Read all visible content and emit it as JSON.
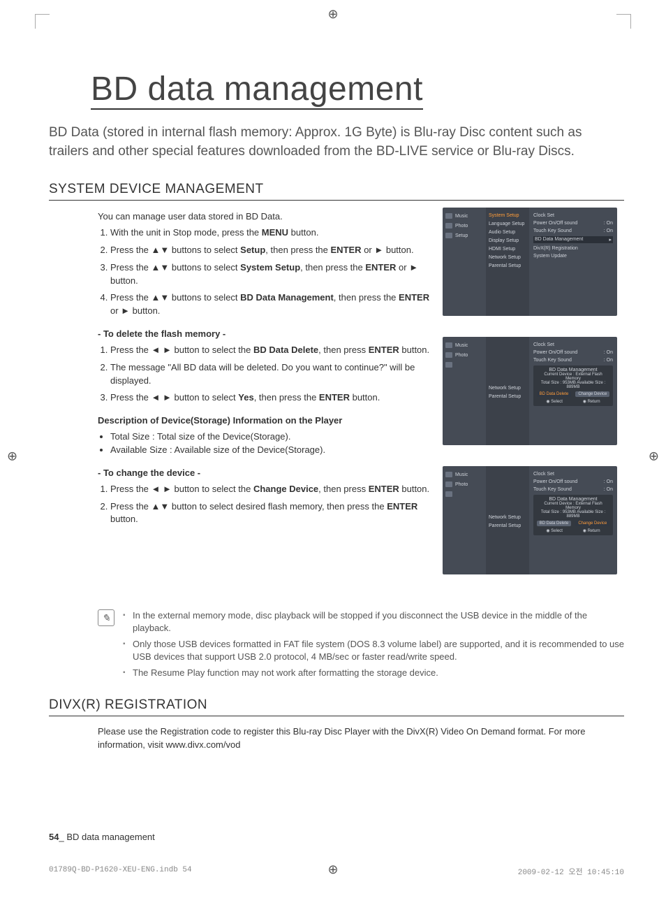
{
  "page": {
    "title": "BD data management",
    "intro": "BD Data (stored in internal flash memory: Approx. 1G Byte) is Blu-ray Disc content such as trailers and other special features downloaded from the BD-LIVE service or Blu-ray Discs.",
    "section1_heading": "SYSTEM DEVICE MANAGEMENT",
    "sdm_intro": "You can manage user data stored in BD Data.",
    "steps": {
      "s1_a": "With the unit in Stop mode, press the ",
      "s1_b": "MENU",
      "s1_c": " button.",
      "s2_a": "Press the ▲▼ buttons to select ",
      "s2_b": "Setup",
      "s2_c": ", then press the ",
      "s2_d": "ENTER",
      "s2_e": " or ► button.",
      "s3_a": "Press the ▲▼ buttons to select ",
      "s3_b": "System Setup",
      "s3_c": ", then press the ",
      "s3_d": "ENTER",
      "s3_e": " or ► button.",
      "s4_a": "Press the ▲▼ buttons to select ",
      "s4_b": "BD Data Management",
      "s4_c": ", then press the  ",
      "s4_d": "ENTER",
      "s4_e": " or ► button."
    },
    "delete_heading": "- To delete the flash memory -",
    "delete_steps": {
      "d1_a": "Press the ◄ ► button to select the ",
      "d1_b": "BD Data Delete",
      "d1_c": ", then press ",
      "d1_d": "ENTER",
      "d1_e": " button.",
      "d2": "The message \"All BD data will be deleted. Do you want to continue?\" will be displayed.",
      "d3_a": "Press the ◄ ► button to select ",
      "d3_b": "Yes",
      "d3_c": ", then press the ",
      "d3_d": "ENTER",
      "d3_e": " button."
    },
    "desc_heading": "Description of Device(Storage) Information on the Player",
    "desc_b1": "Total Size : Total size of the Device(Storage).",
    "desc_b2": "Available Size : Available size of the Device(Storage).",
    "change_heading": "- To change the device -",
    "change_steps": {
      "c1_a": "Press the ◄ ► button to select the ",
      "c1_b": "Change Device",
      "c1_c": ", then press ",
      "c1_d": "ENTER",
      "c1_e": " button.",
      "c2_a": "Press the ▲▼ button to select desired flash memory, then press the ",
      "c2_b": "ENTER",
      "c2_c": " button."
    },
    "notes": {
      "n1": "In the external memory mode, disc playback will be stopped if you disconnect the USB device in the middle of the playback.",
      "n2": "Only those USB devices formatted in FAT file system (DOS 8.3 volume label) are supported, and it is recommended to use USB devices that support USB 2.0 protocol, 4 MB/sec or faster read/write speed.",
      "n3": "The Resume Play function may not work after formatting the storage device."
    },
    "section2_heading": "DIVX(R) REGISTRATION",
    "divx_body": "Please use the Registration code to register this Blu-ray Disc Player with the DivX(R) Video On Demand format. For more information, visit www.divx.com/vod",
    "footer_page_num": "54",
    "footer_sep": "_ ",
    "footer_title": "BD data management",
    "imprint_left": "01789Q-BD-P1620-XEU-ENG.indb   54",
    "imprint_right": "2009-02-12   오전 10:45:10"
  },
  "osd": {
    "left_items": [
      "Music",
      "Photo",
      "Setup"
    ],
    "mid_items": [
      "System Setup",
      "Language Setup",
      "Audio Setup",
      "Display Setup",
      "HDMI Setup",
      "Network Setup",
      "Parental Setup"
    ],
    "right_top": [
      {
        "k": "Clock Set",
        "v": ""
      },
      {
        "k": "Power On/Off sound",
        "v": ": On"
      },
      {
        "k": "Touch Key Sound",
        "v": ": On"
      }
    ],
    "r1_hl": "BD Data Management",
    "r1_after": [
      "DivX(R) Registration",
      "System Update"
    ],
    "panel": {
      "title": "BD Data Management",
      "line1": "Current Device : External Flash Memory",
      "line2": "Total Size : 953MB    Available Size : 889MB",
      "btn_delete": "BD Data Delete",
      "btn_change": "Change Device",
      "foot_select": "Select",
      "foot_return": "Return"
    },
    "ss2_mid_below": [
      "Network Setup",
      "Parental Setup"
    ]
  }
}
